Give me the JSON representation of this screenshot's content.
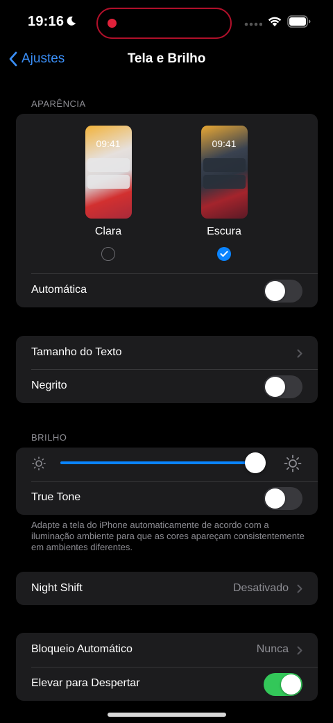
{
  "status_bar": {
    "time": "19:16"
  },
  "nav": {
    "back_label": "Ajustes",
    "title": "Tela e Brilho"
  },
  "appearance": {
    "header": "APARÊNCIA",
    "options": [
      {
        "label": "Clara",
        "preview_time": "09:41",
        "selected": false
      },
      {
        "label": "Escura",
        "preview_time": "09:41",
        "selected": true
      }
    ],
    "automatic_label": "Automática",
    "automatic_on": false
  },
  "text": {
    "size_label": "Tamanho do Texto",
    "bold_label": "Negrito",
    "bold_on": false
  },
  "brightness": {
    "header": "BRILHO",
    "level": 0.97,
    "true_tone_label": "True Tone",
    "true_tone_on": false,
    "footnote": "Adapte a tela do iPhone automaticamente de acordo com a iluminação ambiente para que as cores apareçam consistentemente em ambientes diferentes."
  },
  "night_shift": {
    "label": "Night Shift",
    "value": "Desativado"
  },
  "lock": {
    "auto_lock_label": "Bloqueio Automático",
    "auto_lock_value": "Nunca",
    "raise_to_wake_label": "Elevar para Despertar",
    "raise_to_wake_on": true
  },
  "colors": {
    "accent": "#0a84ff",
    "toggle_on": "#33c759",
    "back_link": "#3a8ef6"
  }
}
